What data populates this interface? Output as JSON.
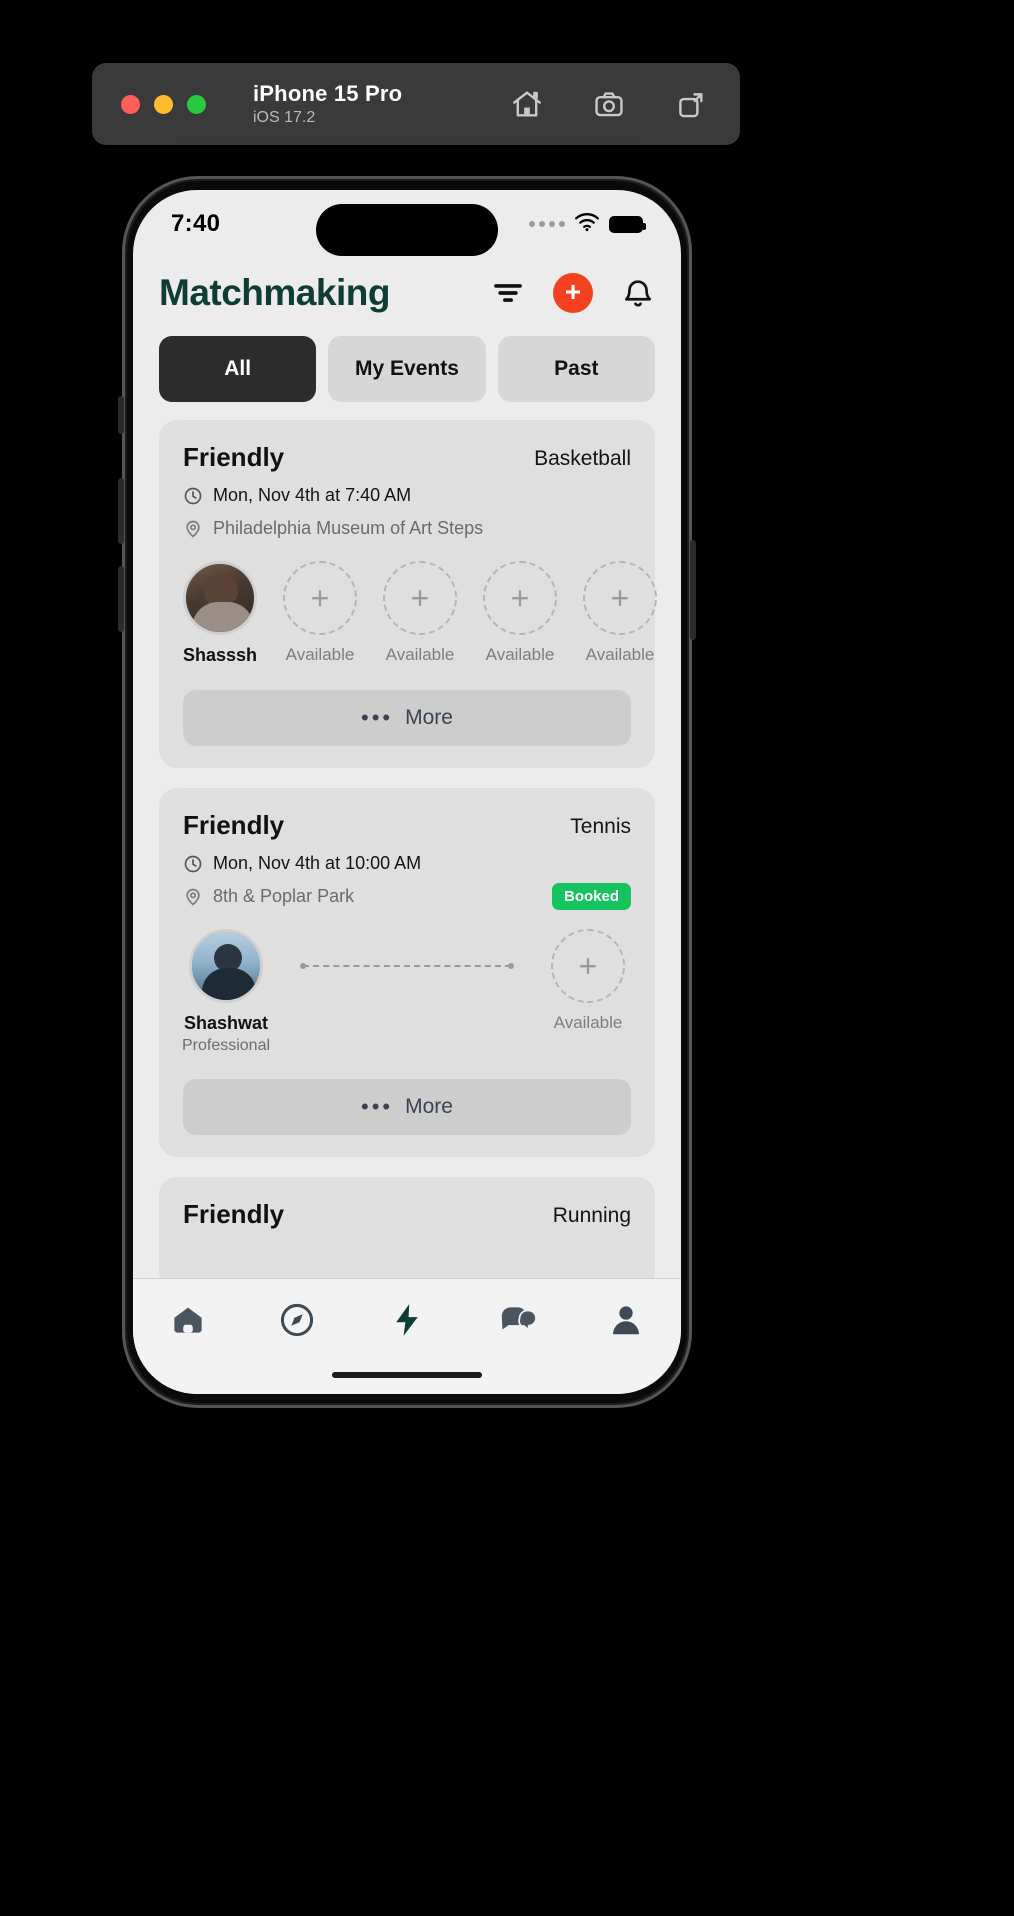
{
  "simulator": {
    "device_name": "iPhone 15 Pro",
    "os_version": "iOS 17.2",
    "window_controls": [
      "close",
      "minimize",
      "zoom"
    ],
    "toolbar_icons": [
      "home-icon",
      "screenshot-icon",
      "rotate-icon"
    ]
  },
  "status_bar": {
    "time": "7:40",
    "cellular": "signal-dots",
    "wifi": "wifi-icon",
    "battery": "battery-icon"
  },
  "header": {
    "title": "Matchmaking",
    "title_color": "#0f3d35",
    "filter_icon": "filter-icon",
    "add_label": "+",
    "add_color": "#f4411f",
    "bell_icon": "bell-icon"
  },
  "tabs": [
    {
      "label": "All",
      "active": true
    },
    {
      "label": "My Events",
      "active": false
    },
    {
      "label": "Past",
      "active": false
    }
  ],
  "cards": [
    {
      "title": "Friendly",
      "sport": "Basketball",
      "time": "Mon, Nov 4th at 7:40 AM",
      "location": "Philadelphia Museum of Art Steps",
      "badge": null,
      "layout": "row",
      "players": [
        {
          "type": "player",
          "name": "Shasssh",
          "role": null,
          "avatar": "a1"
        },
        {
          "type": "slot",
          "label": "Available"
        },
        {
          "type": "slot",
          "label": "Available"
        },
        {
          "type": "slot",
          "label": "Available"
        },
        {
          "type": "slot",
          "label": "Available"
        }
      ],
      "more_label": "More"
    },
    {
      "title": "Friendly",
      "sport": "Tennis",
      "time": "Mon, Nov 4th at 10:00 AM",
      "location": "8th & Poplar Park",
      "badge": {
        "text": "Booked",
        "color": "#16c45f"
      },
      "layout": "duo",
      "players": [
        {
          "type": "player",
          "name": "Shashwat",
          "role": "Professional",
          "avatar": "a2"
        },
        {
          "type": "slot",
          "label": "Available"
        }
      ],
      "more_label": "More"
    },
    {
      "title": "Friendly",
      "sport": "Running",
      "time": null,
      "location": null,
      "badge": null,
      "layout": "partial",
      "players": [],
      "more_label": null
    }
  ],
  "bottom_nav": [
    {
      "name": "home-icon",
      "active": false
    },
    {
      "name": "explore-icon",
      "active": false
    },
    {
      "name": "bolt-icon",
      "active": true
    },
    {
      "name": "chat-icon",
      "active": false
    },
    {
      "name": "profile-icon",
      "active": false
    }
  ],
  "accent": {
    "brand_green": "#0f3d35",
    "orange": "#f4411f",
    "booked_green": "#16c45f"
  }
}
